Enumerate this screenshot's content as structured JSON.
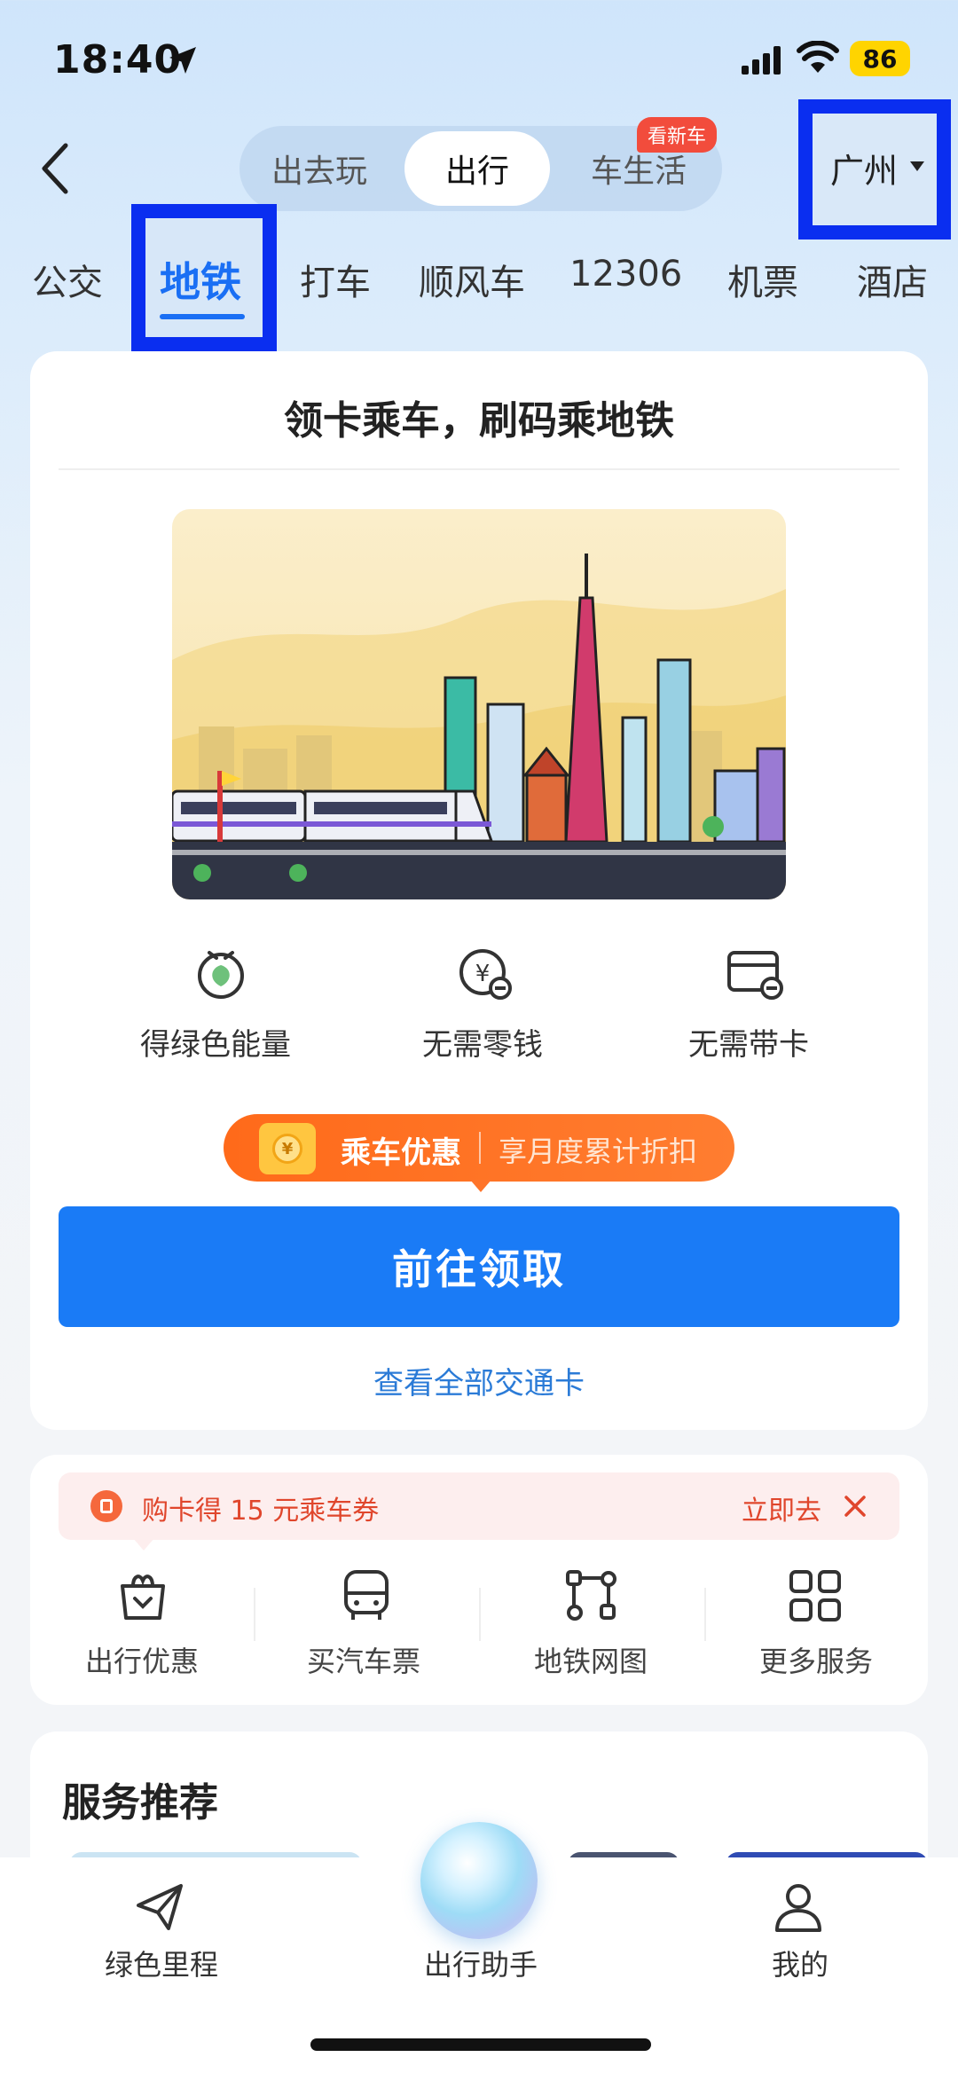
{
  "status_bar": {
    "time": "18:40",
    "battery": "86"
  },
  "header": {
    "segments": [
      "出去玩",
      "出行",
      "车生活"
    ],
    "segment_badge": "看新车",
    "city": "广州"
  },
  "categories": [
    "公交",
    "地铁",
    "打车",
    "顺风车",
    "12306",
    "机票",
    "酒店"
  ],
  "main_card": {
    "title": "领卡乘车，刷码乘地铁",
    "features": [
      "得绿色能量",
      "无需零钱",
      "无需带卡"
    ],
    "promo_title": "乘车优惠",
    "promo_desc": "享月度累计折扣",
    "cta": "前往领取",
    "view_all": "查看全部交通卡"
  },
  "coupon": {
    "text": "购卡得 15 元乘车券",
    "action": "立即去"
  },
  "services": [
    "出行优惠",
    "买汽车票",
    "地铁网图",
    "更多服务"
  ],
  "recommend": {
    "title": "服务推荐"
  },
  "tabbar": {
    "items": [
      "绿色里程",
      "出行助手",
      "我的"
    ]
  },
  "colors": {
    "accent": "#1a7bf6",
    "promo": "#ff6a1a",
    "highlight_box": "#0a2ef0",
    "coupon_text": "#e0462c"
  }
}
